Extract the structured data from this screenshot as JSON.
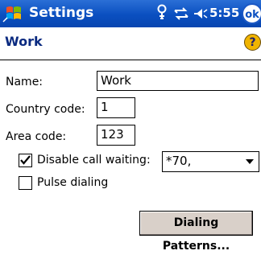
{
  "titlebar": {
    "app_title": "Settings",
    "time": "5:55",
    "ok_label": "ok"
  },
  "page": {
    "title": "Work",
    "help_label": "?"
  },
  "form": {
    "name_label": "Name:",
    "name_value": "Work",
    "country_code_label": "Country code:",
    "country_code_value": "1",
    "area_code_label": "Area code:",
    "area_code_value": "123",
    "disable_call_waiting_label": "Disable call waiting:",
    "disable_call_waiting_checked": true,
    "call_waiting_code": "*70,",
    "pulse_dialing_label": "Pulse dialing",
    "pulse_dialing_checked": false,
    "dialing_patterns_label": "Dialing Patterns..."
  }
}
